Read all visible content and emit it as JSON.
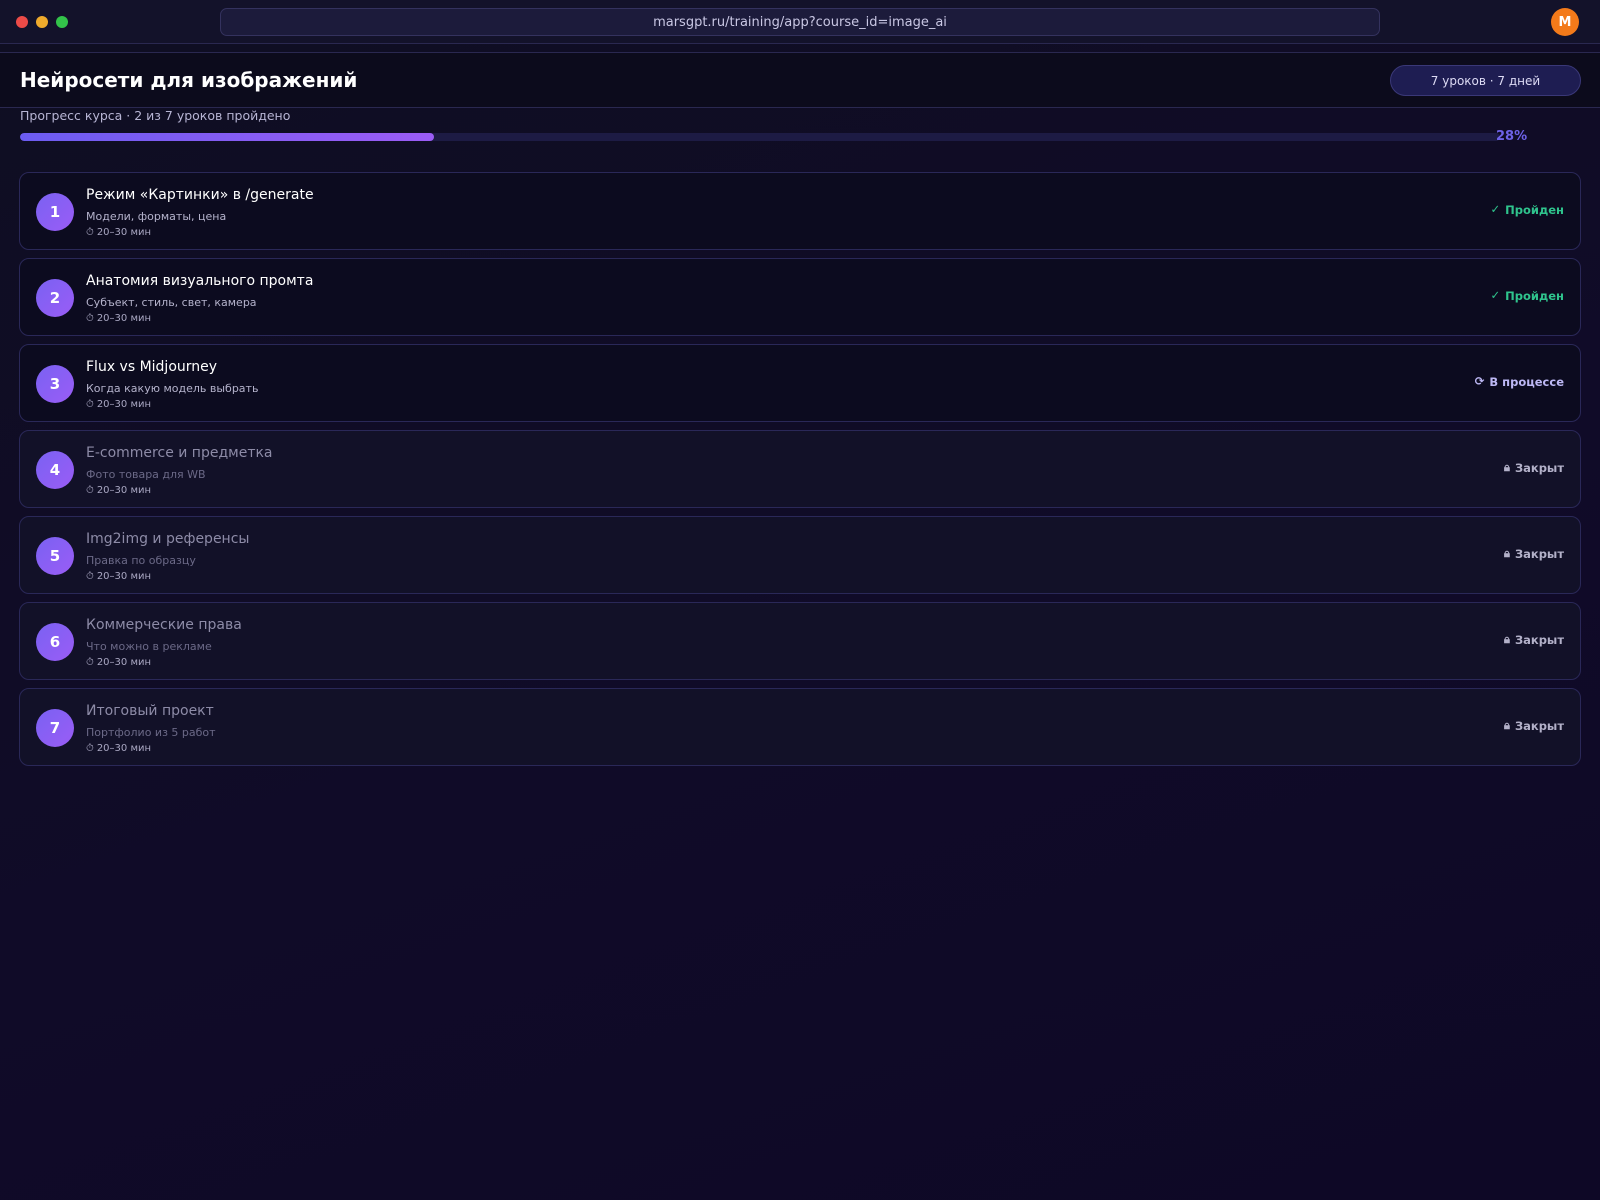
{
  "browser": {
    "url": "marsgpt.ru/training/app?course_id=image_ai",
    "avatar_letter": "M"
  },
  "course": {
    "title": "Нейросети для изображений",
    "meta": "7 уроков · 7 дней"
  },
  "progress": {
    "label": "Прогресс курса · 2 из 7 уроков пройдено",
    "percent_text": "28%",
    "value": 0.28
  },
  "lessons": [
    {
      "number": "1",
      "title": "Режим «Картинки» в /generate",
      "subtitle": "Модели, форматы, цена",
      "duration": "20–30 мин",
      "status": "Пройден",
      "state": "done"
    },
    {
      "number": "2",
      "title": "Анатомия визуального промта",
      "subtitle": "Субъект, стиль, свет, камера",
      "duration": "20–30 мин",
      "status": "Пройден",
      "state": "done"
    },
    {
      "number": "3",
      "title": "Flux vs Midjourney",
      "subtitle": "Когда какую модель выбрать",
      "duration": "20–30 мин",
      "status": "В процессе",
      "state": "in-progress"
    },
    {
      "number": "4",
      "title": "E-commerce и предметка",
      "subtitle": "Фото товара для WB",
      "duration": "20–30 мин",
      "status": "Закрыт",
      "state": "locked"
    },
    {
      "number": "5",
      "title": "Img2img и референсы",
      "subtitle": "Правка по образцу",
      "duration": "20–30 мин",
      "status": "Закрыт",
      "state": "locked"
    },
    {
      "number": "6",
      "title": "Коммерческие права",
      "subtitle": "Что можно в рекламе",
      "duration": "20–30 мин",
      "status": "Закрыт",
      "state": "locked"
    },
    {
      "number": "7",
      "title": "Итоговый проект",
      "subtitle": "Портфолио из 5 работ",
      "duration": "20–30 мин",
      "status": "Закрыт",
      "state": "locked"
    }
  ],
  "icons": {
    "done": "check-icon",
    "in-progress": "refresh-icon",
    "locked": "lock-icon",
    "duration": "clock-icon"
  },
  "colors": {
    "accent": "#7a62f2",
    "done": "#2fc48d",
    "avatar": "#f37a1a"
  }
}
